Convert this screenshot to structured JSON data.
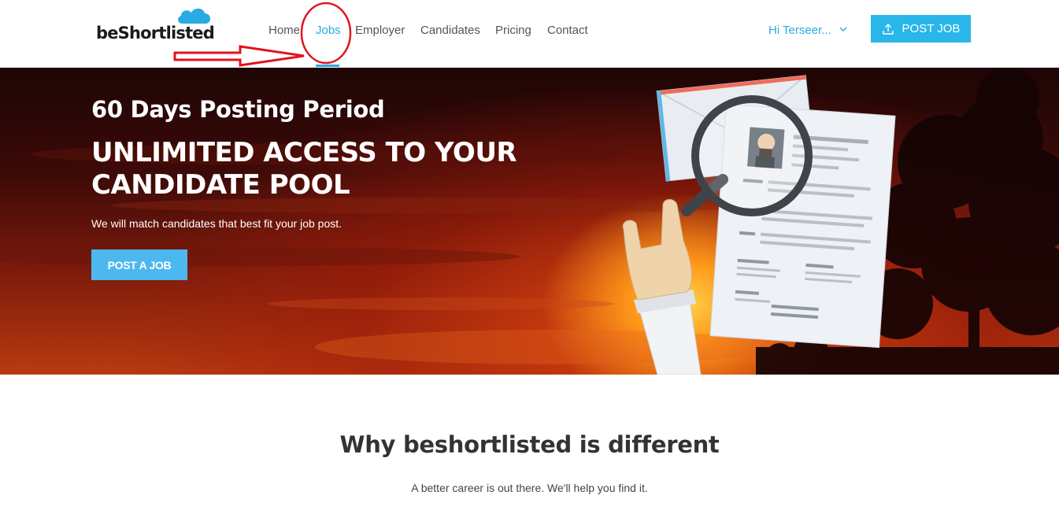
{
  "header": {
    "logo_text": "beShortlisted",
    "nav": [
      {
        "label": "Home"
      },
      {
        "label": "Jobs"
      },
      {
        "label": "Employer"
      },
      {
        "label": "Candidates"
      },
      {
        "label": "Pricing"
      },
      {
        "label": "Contact"
      }
    ],
    "active_nav": "Jobs",
    "user_greeting": "Hi Terseer...",
    "user_chevron_icon": "chevron-down-icon",
    "post_job_label": "POST JOB",
    "post_job_icon": "upload-icon"
  },
  "hero": {
    "subtitle": "60 Days Posting Period",
    "title": "UNLIMITED ACCESS TO YOUR CANDIDATE POOL",
    "text": "We will match candidates that best fit your job post.",
    "button_label": "POST A JOB"
  },
  "section": {
    "title": "Why beshortlisted is different",
    "subtitle": "A better career is out there. We'll help you find it."
  },
  "colors": {
    "accent": "#29aae1",
    "button": "#29b6e9",
    "annotation": "#e0141e"
  }
}
